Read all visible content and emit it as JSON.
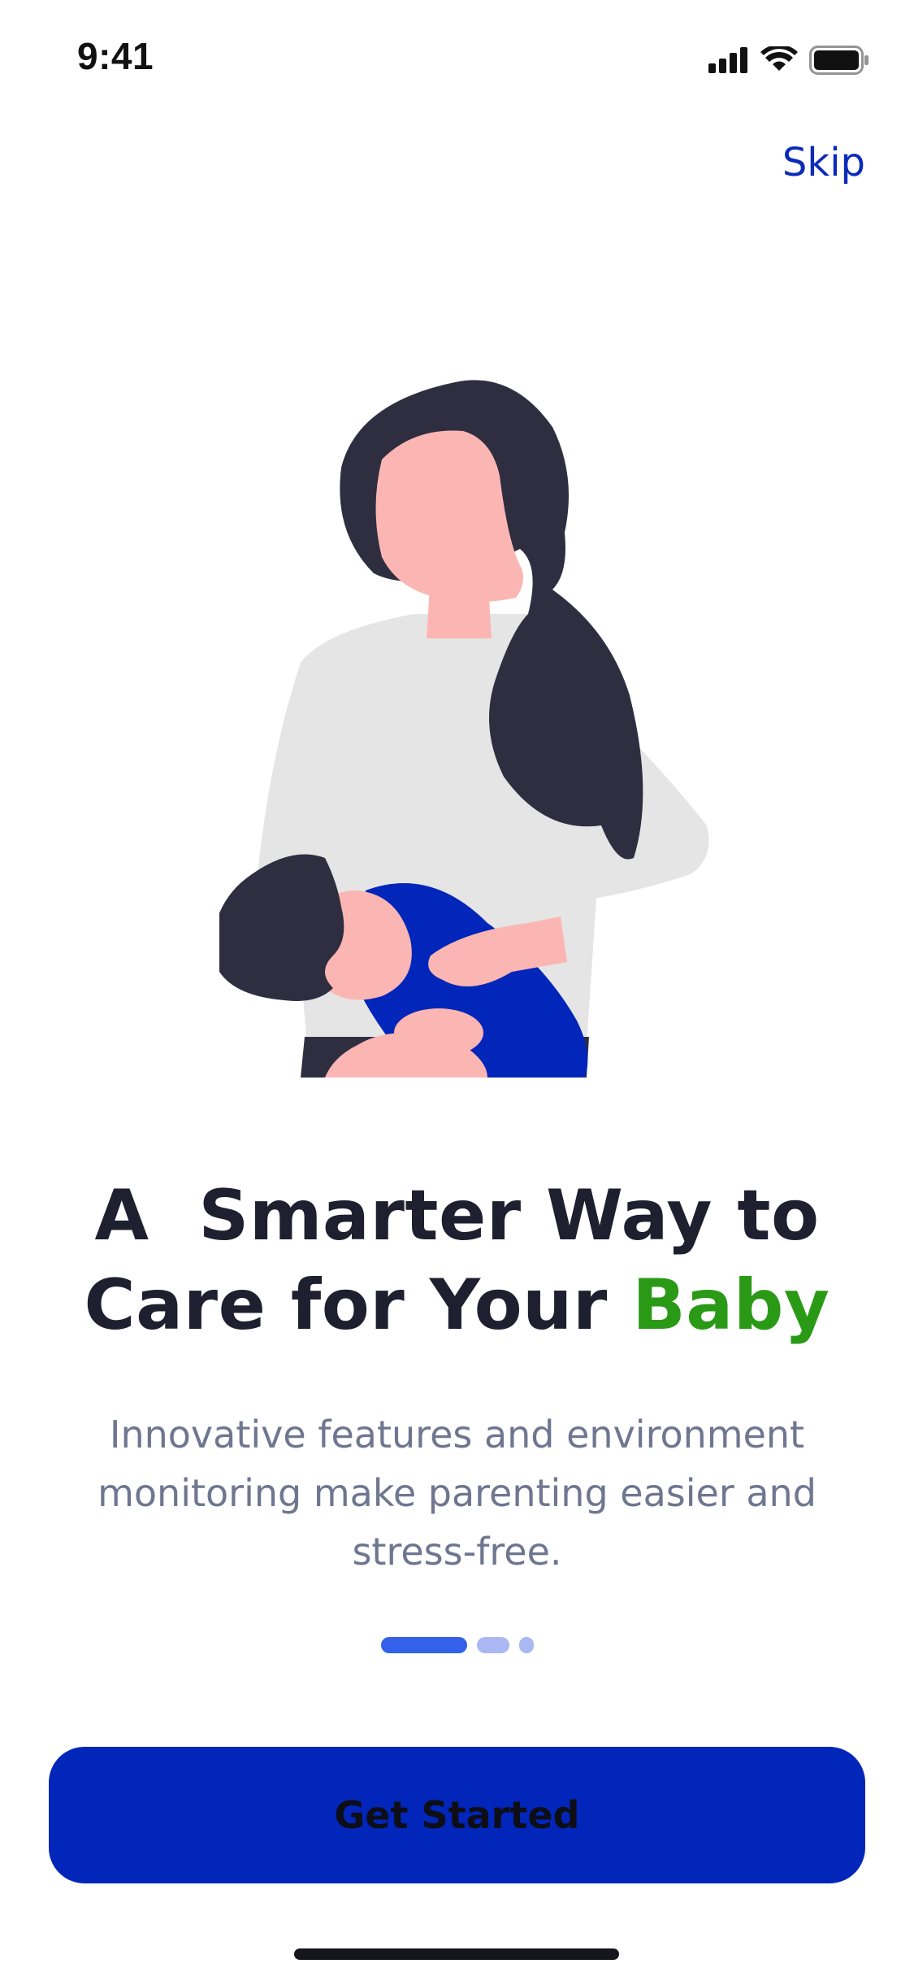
{
  "status_bar": {
    "time": "9:41",
    "icons": [
      "cellular-signal-icon",
      "wifi-icon",
      "battery-icon"
    ]
  },
  "onboarding": {
    "skip_label": "Skip",
    "headline": {
      "line1": "A  Smarter Way to",
      "line2_prefix": "Care for Your ",
      "line2_accent": "Baby"
    },
    "description": "Innovative features and environment monitoring make parenting easier and stress-free.",
    "pager": {
      "current_page": 1,
      "total_pages": 3
    },
    "cta_label": "Get Started"
  },
  "colors": {
    "accent_green": "#2A9A16",
    "primary_blue": "#0226B9",
    "skip_blue": "#0B2BB8",
    "headline_text": "#1E2030",
    "body_text": "#6F7690",
    "pager_active": "#3461EA",
    "pager_inactive": "#A9B8F2"
  }
}
